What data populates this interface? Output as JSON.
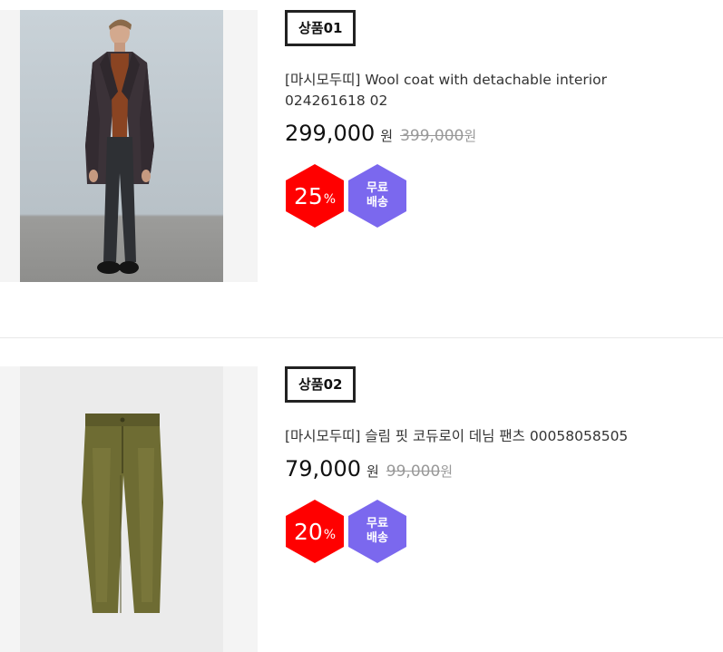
{
  "products": [
    {
      "tag": "상품01",
      "name": "[마시모두띠] Wool coat with detachable interior 024261618 02",
      "price": "299,000",
      "price_unit": "원",
      "original_price": "399,000",
      "original_unit": "원",
      "discount_percent": "25",
      "percent_sign": "%",
      "shipping_line1": "무료",
      "shipping_line2": "배송",
      "image": "model-in-wool-coat"
    },
    {
      "tag": "상품02",
      "name": "[마시모두띠] 슬림 핏 코듀로이 데님 팬츠 00058058505",
      "price": "79,000",
      "price_unit": "원",
      "original_price": "99,000",
      "original_unit": "원",
      "discount_percent": "20",
      "percent_sign": "%",
      "shipping_line1": "무료",
      "shipping_line2": "배송",
      "image": "corduroy-pants"
    }
  ],
  "colors": {
    "sale_badge": "#ff0000",
    "shipping_badge": "#7b68ee",
    "original_price": "#999999"
  }
}
